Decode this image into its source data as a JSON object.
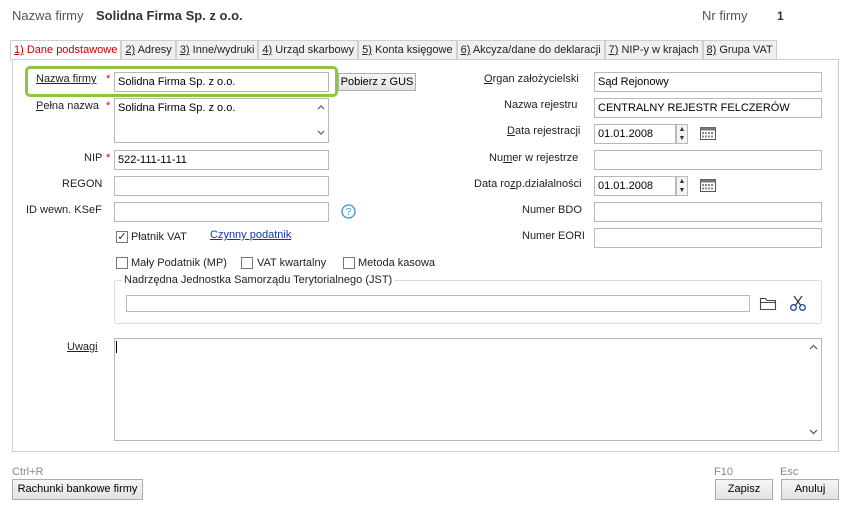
{
  "header": {
    "name_label": "Nazwa firmy",
    "name_value": "Solidna Firma Sp. z o.o.",
    "nr_label": "Nr firmy",
    "nr_value": "1"
  },
  "tabs": [
    {
      "key": "1)",
      "label": " Dane podstawowe"
    },
    {
      "key": "2)",
      "label": " Adresy"
    },
    {
      "key": "3)",
      "label": " Inne/wydruki"
    },
    {
      "key": "4)",
      "label": " Urząd skarbowy"
    },
    {
      "key": "5)",
      "label": " Konta księgowe"
    },
    {
      "key": "6)",
      "label": " Akcyza/dane do deklaracji"
    },
    {
      "key": "7)",
      "label": " NIP-y w krajach"
    },
    {
      "key": "8)",
      "label": " Grupa VAT"
    }
  ],
  "left": {
    "nazwa_label": "Nazwa firmy",
    "nazwa_value": "Solidna Firma Sp. z o.o.",
    "gus_button": "Pobierz z GUS",
    "pelna_label": "Pełna nazwa",
    "pelna_value": "Solidna Firma Sp. z o.o.",
    "nip_label": "NIP",
    "nip_value": "522-111-11-11",
    "regon_label": "REGON",
    "regon_value": "",
    "ksef_label": "ID wewn. KSeF",
    "ksef_value": "",
    "platnik_label": "Płatnik VAT",
    "czynny_link": "Czynny podatnik",
    "maly_label": "Mały Podatnik (MP)",
    "vatkw_label": "VAT kwartalny",
    "kasowa_label": "Metoda kasowa",
    "jst_legend": "Nadrzędna Jednostka Samorządu Terytorialnego (JST)",
    "jst_value": "",
    "uwagi_label": "Uwagi",
    "uwagi_value": ""
  },
  "right": {
    "organ_label": "Organ założycielski",
    "organ_value": "Sąd Rejonowy",
    "rejestr_label": "Nazwa rejestru",
    "rejestr_value": "CENTRALNY REJESTR FELCZERÓW",
    "data_rej_label": "Data rejestracji",
    "data_rej_value": "01.01.2008",
    "numer_label": "Numer w rejestrze",
    "numer_value": "",
    "data_roz_label": "Data rozp.działalności",
    "data_roz_value": "01.01.2008",
    "bdo_label": "Numer BDO",
    "bdo_value": "",
    "eori_label": "Numer EORI",
    "eori_value": ""
  },
  "footer": {
    "ctrl_hint": "Ctrl+R",
    "rachunki_button": "Rachunki bankowe firmy",
    "f10_hint": "F10",
    "zapisz_button": "Zapisz",
    "esc_hint": "Esc",
    "anuluj_button": "Anuluj"
  },
  "colors": {
    "focus_border": "#8cc63f",
    "active_tab_text": "#c00000",
    "required_star": "#d40000",
    "link": "#1a33a8",
    "help_icon": "#3a8dde"
  },
  "icons": [
    "calendar-icon",
    "folder-icon",
    "scissors-icon",
    "help-icon",
    "scroll-up-icon",
    "scroll-down-icon",
    "spin-up-icon",
    "spin-down-icon",
    "checkmark-icon"
  ]
}
